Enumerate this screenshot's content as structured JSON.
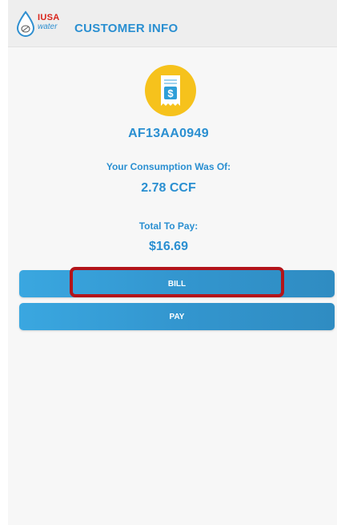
{
  "header": {
    "logo_top": "IUSA",
    "logo_bottom": "water",
    "title": "CUSTOMER INFO"
  },
  "account_number": "AF13AA0949",
  "consumption": {
    "label": "Your Consumption Was Of:",
    "value": "2.78 CCF"
  },
  "total": {
    "label": "Total To Pay:",
    "value": "$16.69"
  },
  "buttons": {
    "bill_label": "BILL",
    "pay_label": "PAY"
  },
  "colors": {
    "accent": "#2a8fd1",
    "button": "#3396cf",
    "icon_circle": "#f6c21c",
    "highlight": "#b3141a"
  },
  "icons": [
    "water-drop-logo-icon",
    "receipt-dollar-icon"
  ]
}
